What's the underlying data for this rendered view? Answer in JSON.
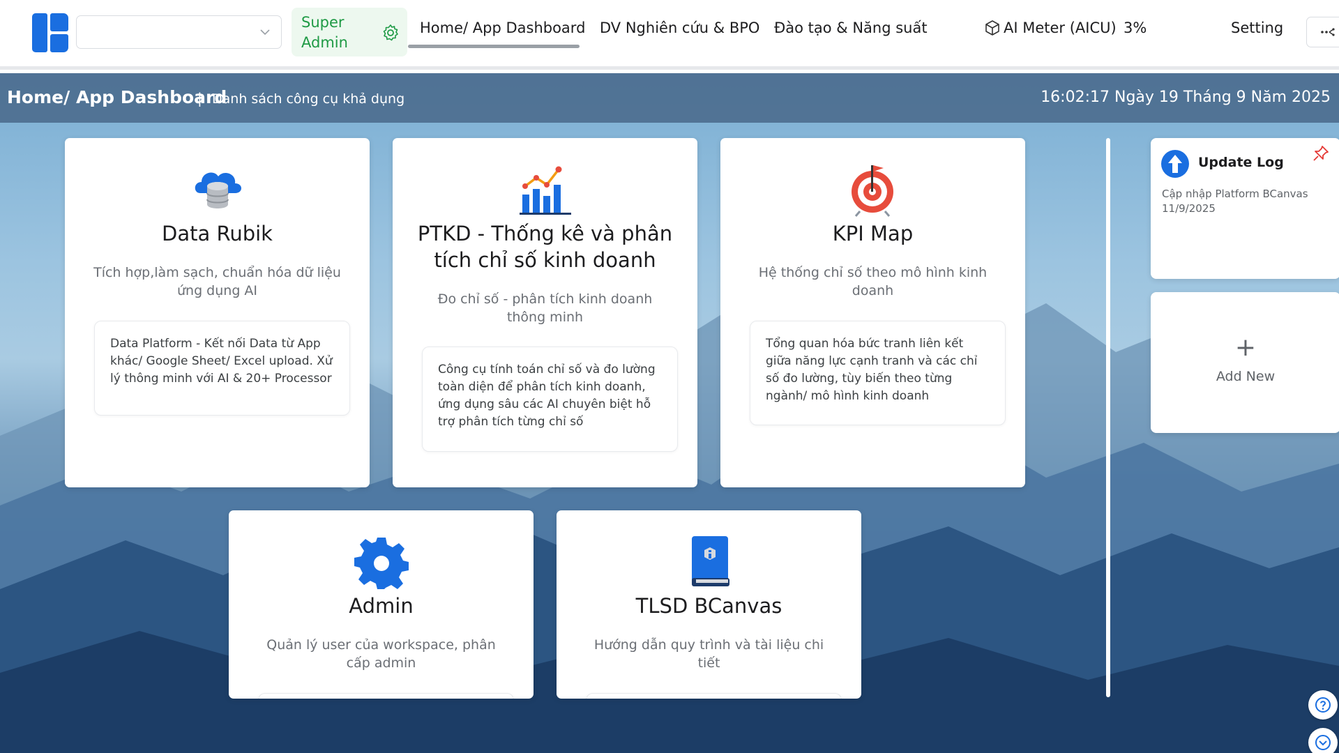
{
  "header": {
    "workspace_select_value": "",
    "role_label": "Super Admin",
    "nav_tabs": [
      {
        "label": "Home/ App Dashboard",
        "active": true
      },
      {
        "label": "DV Nghiên cứu & BPO",
        "active": false
      },
      {
        "label": "Đào tạo & Năng suất",
        "active": false
      }
    ],
    "ai_meter_label": "AI Meter (AICU)",
    "ai_meter_value": "3%",
    "setting_label": "Setting"
  },
  "breadcrumb": {
    "title": "Home/ App Dashboard",
    "separator": "|",
    "subtitle": "Danh sách công cụ khả dụng",
    "datetime": "16:02:17 Ngày 19 Tháng 9 Năm 2025"
  },
  "apps": [
    {
      "title": "Data Rubik",
      "icon": "cloud-database-icon",
      "description": "Tích hợp,làm sạch, chuẩn hóa dữ liệu ứng dụng AI",
      "detail": "Data Platform - Kết nối Data từ App khác/ Google Sheet/ Excel upload. Xử lý thông minh với AI & 20+ Processor"
    },
    {
      "title": "PTKD - Thống kê và phân tích chỉ số kinh doanh",
      "icon": "bar-chart-icon",
      "description": "Đo chỉ số - phân tích kinh doanh thông minh",
      "detail": "Công cụ tính toán chỉ số và đo lường toàn diện để phân tích kinh doanh, ứng dụng sâu các AI chuyên biệt hỗ trợ phân tích từng chỉ số"
    },
    {
      "title": "KPI Map",
      "icon": "target-icon",
      "description": "Hệ thống chỉ số theo mô hình kinh doanh",
      "detail": "Tổng quan hóa bức tranh liên kết giữa năng lực cạnh tranh và các chỉ số đo lường, tùy biến theo từng ngành/ mô hình kinh doanh"
    },
    {
      "title": "Admin",
      "icon": "gear-icon",
      "description": "Quản lý user của workspace, phân cấp admin",
      "detail": ""
    },
    {
      "title": "TLSD BCanvas",
      "icon": "book-info-icon",
      "description": "Hướng dẫn quy trình và tài liệu chi tiết",
      "detail": ""
    }
  ],
  "side_panel": {
    "update_log_title": "Update Log",
    "update_log_text": "Cập nhập Platform BCanvas 11/9/2025",
    "add_new_symbol": "+",
    "add_new_label": "Add New"
  },
  "colors": {
    "brand_blue": "#1a6ee0",
    "role_green": "#1f9a45",
    "header_strip": "#4a6a8c"
  }
}
